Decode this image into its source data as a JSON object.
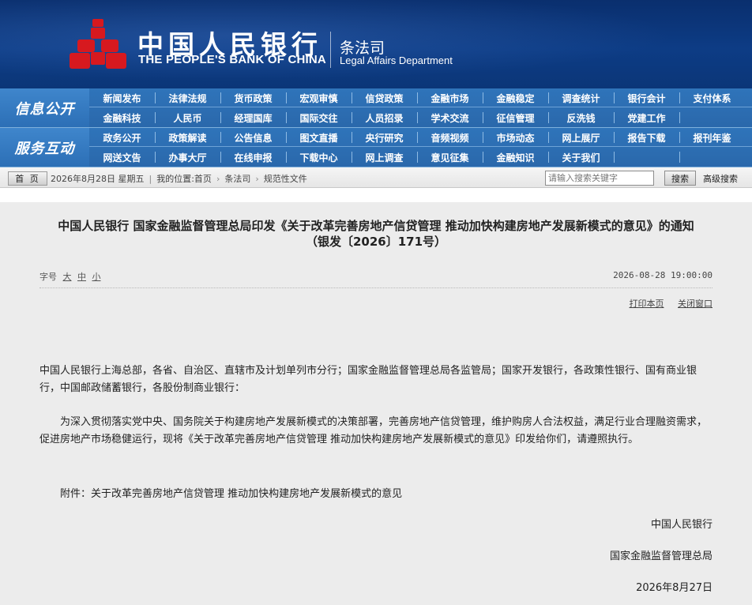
{
  "header": {
    "logo_cn": "中国人民银行",
    "logo_en": "THE PEOPLE'S BANK OF CHINA",
    "dept_cn": "条法司",
    "dept_en": "Legal Affairs Department"
  },
  "nav": {
    "section1": {
      "label": "信息公开",
      "row1": [
        "新闻发布",
        "法律法规",
        "货币政策",
        "宏观审慎",
        "信贷政策",
        "金融市场",
        "金融稳定",
        "调查统计",
        "银行会计",
        "支付体系"
      ],
      "row2": [
        "金融科技",
        "人民币",
        "经理国库",
        "国际交往",
        "人员招录",
        "学术交流",
        "征信管理",
        "反洗钱",
        "党建工作",
        ""
      ]
    },
    "section2": {
      "label": "服务互动",
      "row1": [
        "政务公开",
        "政策解读",
        "公告信息",
        "图文直播",
        "央行研究",
        "音频视频",
        "市场动态",
        "网上展厅",
        "报告下载",
        "报刊年鉴"
      ],
      "row2": [
        "网送文告",
        "办事大厅",
        "在线申报",
        "下载中心",
        "网上调查",
        "意见征集",
        "金融知识",
        "关于我们",
        "",
        ""
      ]
    }
  },
  "crumbbar": {
    "home_label": "首 页",
    "date": "2026年8月28日 星期五",
    "location_label": "我的位置:首页",
    "crumb1": "条法司",
    "crumb2": "规范性文件",
    "search_placeholder": "请输入搜索关键字",
    "search_button": "搜索",
    "advanced_search": "高级搜索"
  },
  "article": {
    "title_line1": "中国人民银行  国家金融监督管理总局印发《关于改革完善房地产信贷管理  推动加快构建房地产发展新模式的意见》的通知",
    "title_line2": "（银发〔2026〕171号）",
    "font_size_label": "字号",
    "font_sizes": [
      "大",
      "中",
      "小"
    ],
    "publish_time": "2026-08-28 19:00:00",
    "print_link": "打印本页",
    "close_link": "关闭窗口",
    "salutation": "中国人民银行上海总部，各省、自治区、直辖市及计划单列市分行；国家金融监督管理总局各监管局；国家开发银行，各政策性银行、国有商业银行，中国邮政储蓄银行，各股份制商业银行：",
    "main_paragraph": "为深入贯彻落实党中央、国务院关于构建房地产发展新模式的决策部署，完善房地产信贷管理，维护购房人合法权益，满足行业合理融资需求，促进房地产市场稳健运行，现将《关于改革完善房地产信贷管理  推动加快构建房地产发展新模式的意见》印发给你们，请遵照执行。",
    "attachment": "附件：关于改革完善房地产信贷管理  推动加快构建房地产发展新模式的意见",
    "signatory1": "中国人民银行",
    "signatory2": "国家金融监督管理总局",
    "date": "2026年8月27日"
  },
  "colors": {
    "banner": "#0d3c85",
    "nav_bg": "#2f74ba",
    "section_label_bg": "#3f86cc",
    "content_bg": "#ececec",
    "logo_red": "#d7191f"
  }
}
